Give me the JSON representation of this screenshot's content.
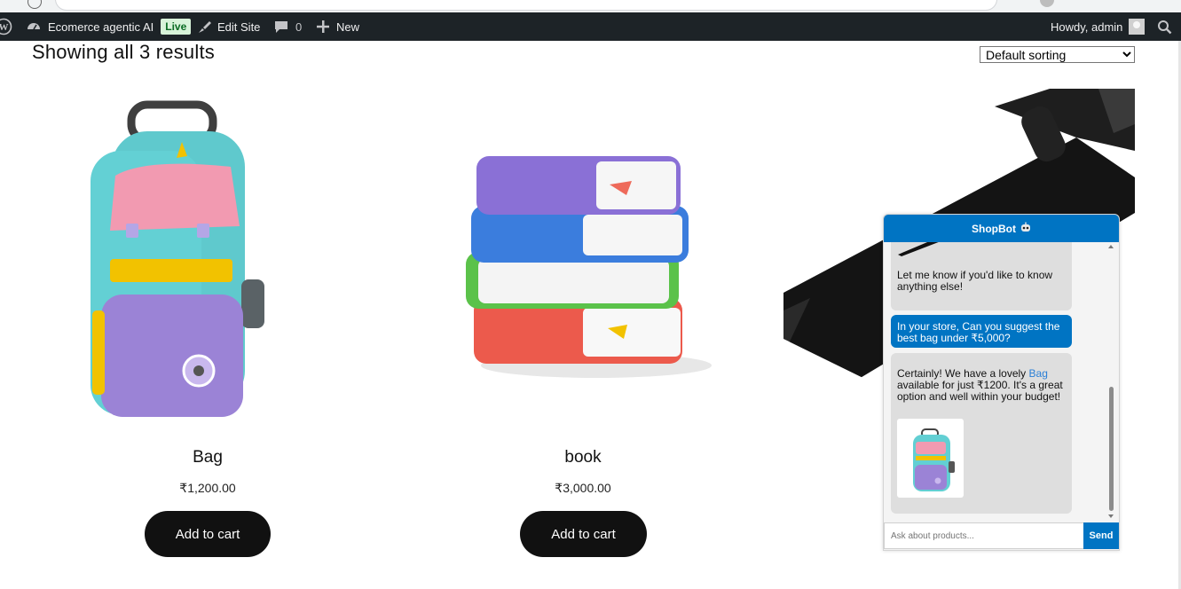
{
  "admin_bar": {
    "site_name": "Ecomerce agentic AI",
    "live_badge": "Live",
    "edit_site": "Edit Site",
    "comments_count": "0",
    "new_label": "New",
    "howdy": "Howdy, admin"
  },
  "shop": {
    "results_text": "Showing all 3 results",
    "sort_selected": "Default sorting"
  },
  "products": [
    {
      "title": "Bag",
      "price": "₹1,200.00",
      "button": "Add to cart"
    },
    {
      "title": "book",
      "price": "₹3,000.00",
      "button": "Add to cart"
    }
  ],
  "chat": {
    "title": "ShopBot",
    "messages": [
      {
        "role": "bot",
        "text": "Let me know if you'd like to know anything else!"
      },
      {
        "role": "user",
        "text": "In your store, Can you suggest the best bag under ₹5,000?"
      },
      {
        "role": "bot",
        "text_before": "Certainly! We have a lovely ",
        "link": "Bag",
        "text_after": " available for just ₹1200. It's a great option and well within your budget!"
      }
    ],
    "input_placeholder": "Ask about products...",
    "send_label": "Send"
  },
  "colors": {
    "admin_bar": "#1d2327",
    "chat_accent": "#0074c3",
    "button_dark": "#111111",
    "live_badge_bg": "#d8f3d9"
  }
}
